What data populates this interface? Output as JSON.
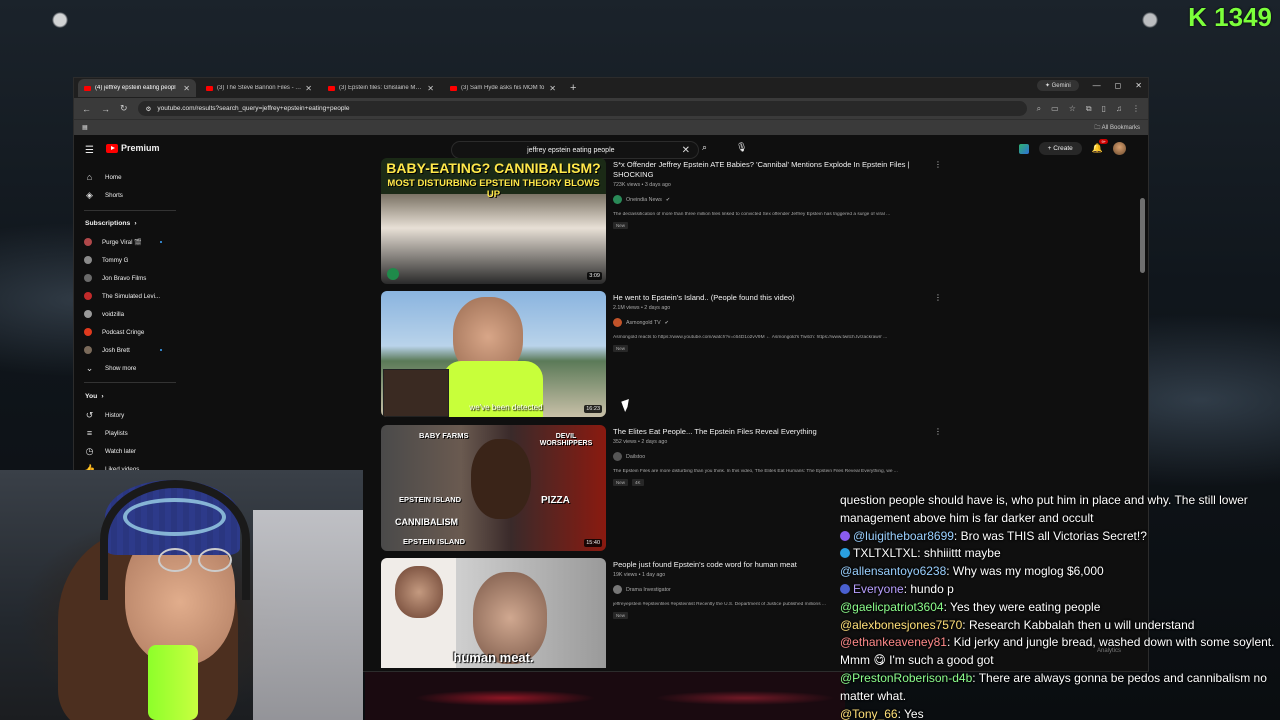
{
  "counter": {
    "icon": "K",
    "value": "1349"
  },
  "browser": {
    "tabs": [
      {
        "label": "(4) jeffrey epstein eating peopl",
        "active": true
      },
      {
        "label": "(3) The Steve Bannon Files - Yo",
        "active": false
      },
      {
        "label": "(3) Epstein files: Ghislaine Maxw",
        "active": false
      },
      {
        "label": "(3) Sam Hyde asks his MOM fo",
        "active": false
      }
    ],
    "new_tab": "+",
    "gemini": "Gemini",
    "window_controls": {
      "minimize": "—",
      "maximize": "◻",
      "close": "✕"
    },
    "url": "youtube.com/results?search_query=jeffrey+epstein+eating+people",
    "all_bookmarks": "All Bookmarks"
  },
  "youtube": {
    "logo_text": "Premium",
    "search_query": "jeffrey epstein eating people",
    "create_label": "Create",
    "notification_count": "9+"
  },
  "sidebar": {
    "top": [
      {
        "label": "Home",
        "icon": "home-icon"
      },
      {
        "label": "Shorts",
        "icon": "shorts-icon"
      }
    ],
    "subscriptions_heading": "Subscriptions",
    "subscriptions": [
      {
        "label": "Purge Viral 🎬",
        "color": "#b0484a",
        "dot": true
      },
      {
        "label": "Tommy G",
        "color": "#8a8a8a",
        "dot": false
      },
      {
        "label": "Jon Bravo Films",
        "color": "#6a6a6a",
        "dot": false
      },
      {
        "label": "The Simulated Levi...",
        "color": "#c22b2b",
        "dot": false
      },
      {
        "label": "voidzilla",
        "color": "#9a9a9a",
        "dot": false
      },
      {
        "label": "Podcast Cringe",
        "color": "#e03a1e",
        "dot": false
      },
      {
        "label": "Josh Brett",
        "color": "#7a6a5a",
        "dot": true
      }
    ],
    "show_more": "Show more",
    "you_heading": "You",
    "you_items": [
      {
        "label": "History",
        "icon": "history-icon"
      },
      {
        "label": "Playlists",
        "icon": "playlists-icon"
      },
      {
        "label": "Watch later",
        "icon": "watch-later-icon"
      },
      {
        "label": "Liked videos",
        "icon": "liked-videos-icon"
      }
    ]
  },
  "videos": [
    {
      "title": "S*x Offender Jeffrey Epstein ATE Babies? 'Cannibal' Mentions Explode In Epstein Files | SHOCKING",
      "meta": "723K views • 3 days ago",
      "channel": "Oneindia News",
      "description": "The declassification of more than three million files linked to convicted Sex offender Jeffrey Epstein has triggered a surge of viral ...",
      "badges": [
        "New"
      ],
      "duration": "3:09",
      "thumb_text_1": "BABY-EATING? CANNIBALISM?",
      "thumb_text_2": "MOST DISTURBING EPSTEIN THEORY BLOWS UP"
    },
    {
      "title": "He went to Epstein's Island.. (People found this video)",
      "meta": "2.1M views • 2 days ago",
      "channel": "Asmongold TV",
      "description": "Asmongold reacts to https://www.youtube.com/watch?v=c64D1o2vV9M ← Asmongold's Twitch: https://www.twitch.tv/zackrawrr ...",
      "badges": [
        "New"
      ],
      "duration": "16:23",
      "thumb_text_1": "we've been detected"
    },
    {
      "title": "The Elites Eat People... The Epstein Files Reveal Everything",
      "meta": "352 views • 2 days ago",
      "channel": "Dailstoo",
      "description": "The Epstein Files are more disturbing than you think. In this video, The Elites Eat Humans: The Epstein Files Reveal Everything, we ...",
      "badges": [
        "New",
        "4K"
      ],
      "duration": "15:40",
      "thumb_text_1": "BABY FARMS",
      "thumb_text_2": "DEVIL WORSHIPPERS",
      "thumb_text_3": "EPSTEIN ISLAND",
      "thumb_text_4": "CANNIBALISM",
      "thumb_text_5": "PIZZA",
      "thumb_text_6": "EPSTEIN ISLAND"
    },
    {
      "title": "People just found Epstein's code word for human meat",
      "meta": "19K views • 1 day ago",
      "channel": "Drama Investigator",
      "description": "jeffreyepstein #epsteinfiles #epsteinlist Recently the U.S. Department of Justice published millions ...",
      "badges": [
        "New"
      ],
      "duration": "",
      "thumb_text_1": "human meat."
    }
  ],
  "chat": [
    {
      "user": "",
      "text": "question people should have is, who put him in place and why. The still lower management above him is far darker and occult",
      "color": "#ffffff",
      "badge": ""
    },
    {
      "user": "@luigitheboar8699",
      "text": ": Bro was THIS all Victorias Secret!?",
      "color": "#9ad0ff",
      "badge": "#8a5cf0"
    },
    {
      "user": "TXLTXLTXL",
      "text": ": shhiiittt maybe",
      "color": "#ffffff",
      "badge": "#2aa0e0"
    },
    {
      "user": "@allensantoyo6238",
      "text": ": Why was my moglog $6,000",
      "color": "#9ad0ff",
      "badge": ""
    },
    {
      "user": "Everyone",
      "text": ": hundo p",
      "color": "#b9a0ff",
      "badge": "#4a60d0"
    },
    {
      "user": "@gaelicpatriot3604",
      "text": ": Yes they were eating people",
      "color": "#8dff8d",
      "badge": ""
    },
    {
      "user": "@alexbonesjones7570",
      "text": ": Research Kabbalah then u will understand",
      "color": "#ffe07a",
      "badge": ""
    },
    {
      "user": "@ethankeaveney81",
      "text": ": Kid jerky and jungle bread, washed down with some soylent. Mmm 😋 I'm such a good got",
      "color": "#ff8a8a",
      "badge": ""
    },
    {
      "user": "@PrestonRoberison-d4b",
      "text": ": There are always gonna be pedos and cannibalism no matter what.",
      "color": "#8dff8d",
      "badge": ""
    },
    {
      "user": "@Tony_66",
      "text": ": Yes",
      "color": "#ffe07a",
      "badge": ""
    }
  ],
  "analytics_label": "Analytics",
  "colors": {
    "yt_red": "#ff0000",
    "counter_green": "#7cff3b",
    "link_blue": "#3ea6ff"
  }
}
